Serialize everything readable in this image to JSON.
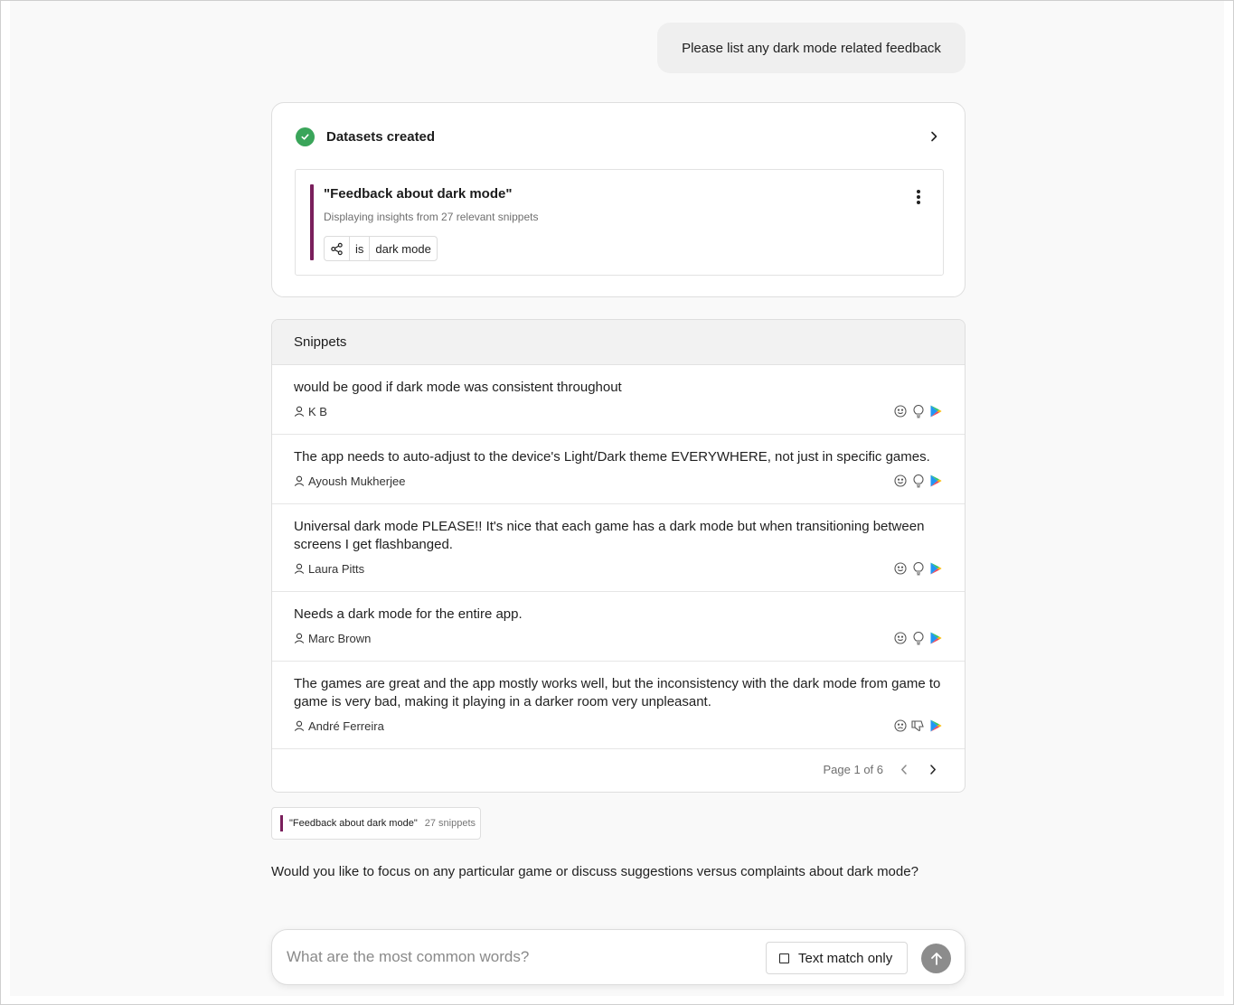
{
  "user_message": "Please list any dark mode related feedback",
  "datasets": {
    "title": "Datasets created",
    "item": {
      "name": "\"Feedback about dark mode\"",
      "subtitle": "Displaying insights from 27 relevant snippets",
      "filter": {
        "operator": "is",
        "value": "dark mode"
      }
    }
  },
  "snippets": {
    "header": "Snippets",
    "rows": [
      {
        "text": "would be good if dark mode was consistent throughout",
        "author": "K B",
        "sentiment": "neutral",
        "type": "suggestion",
        "source": "google-play"
      },
      {
        "text": "The app needs to auto-adjust to the device's Light/Dark theme EVERYWHERE, not just in specific games.",
        "author": "Ayoush Mukherjee",
        "sentiment": "neutral",
        "type": "suggestion",
        "source": "google-play"
      },
      {
        "text": "Universal dark mode PLEASE!! It's nice that each game has a dark mode but when transitioning between screens I get flashbanged.",
        "author": "Laura Pitts",
        "sentiment": "neutral",
        "type": "suggestion",
        "source": "google-play"
      },
      {
        "text": "Needs a dark mode for the entire app.",
        "author": "Marc Brown",
        "sentiment": "neutral",
        "type": "suggestion",
        "source": "google-play"
      },
      {
        "text": "The games are great and the app mostly works well, but the inconsistency with the dark mode from game to game is very bad, making it playing in a darker room very unpleasant.",
        "author": "André Ferreira",
        "sentiment": "negative",
        "type": "complaint",
        "source": "google-play"
      }
    ],
    "pagination": "Page 1 of 6"
  },
  "dataset_tag": {
    "name": "\"Feedback about dark mode\"",
    "count": "27 snippets"
  },
  "assistant_message": "Would you like to focus on any particular game or discuss suggestions versus complaints about dark mode?",
  "composer": {
    "placeholder": "What are the most common words?",
    "text_match_label": "Text match only"
  },
  "colors": {
    "accent": "#7a1f5c",
    "success": "#3aa55a",
    "send_button": "#8c8c8c"
  }
}
